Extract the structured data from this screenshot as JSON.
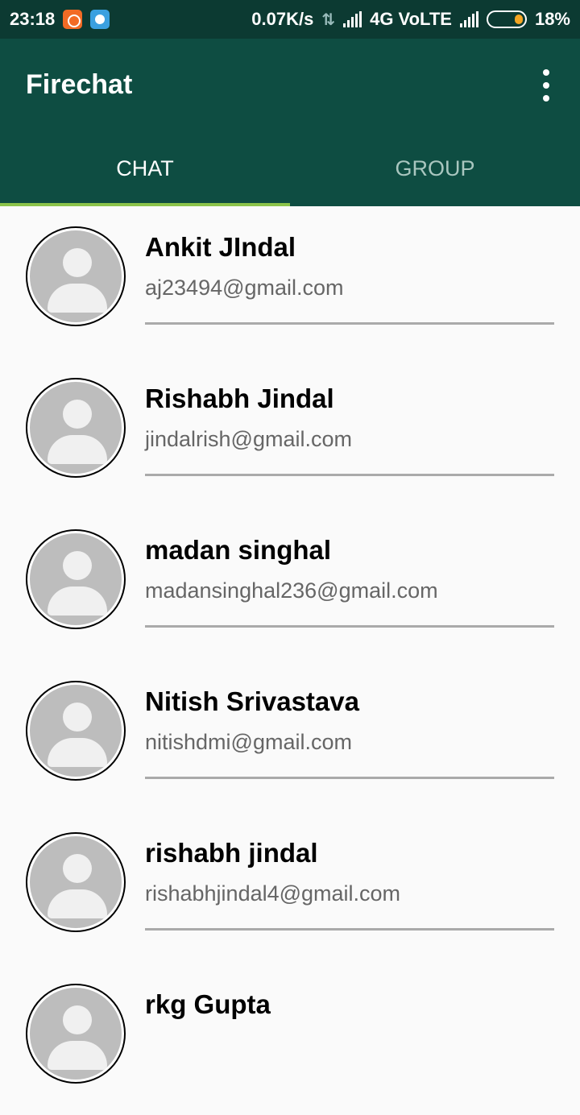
{
  "status_bar": {
    "time": "23:18",
    "speed": "0.07K/s",
    "network": "4G VoLTE",
    "battery": "18%"
  },
  "app_bar": {
    "title": "Firechat",
    "menu_icon": "more-vert-icon"
  },
  "tabs": [
    {
      "label": "CHAT",
      "selected": true
    },
    {
      "label": "GROUP",
      "selected": false
    }
  ],
  "colors": {
    "status_bar": "#0c3a32",
    "app_bar": "#0e4d42",
    "tab_indicator": "#8bc34a"
  },
  "contacts": [
    {
      "name": "Ankit JIndal",
      "email": "aj23494@gmail.com"
    },
    {
      "name": "Rishabh Jindal",
      "email": "jindalrish@gmail.com"
    },
    {
      "name": "madan singhal",
      "email": "madansinghal236@gmail.com"
    },
    {
      "name": "Nitish Srivastava",
      "email": "nitishdmi@gmail.com"
    },
    {
      "name": "rishabh jindal",
      "email": "rishabhjindal4@gmail.com"
    },
    {
      "name": "rkg Gupta",
      "email": ""
    }
  ]
}
